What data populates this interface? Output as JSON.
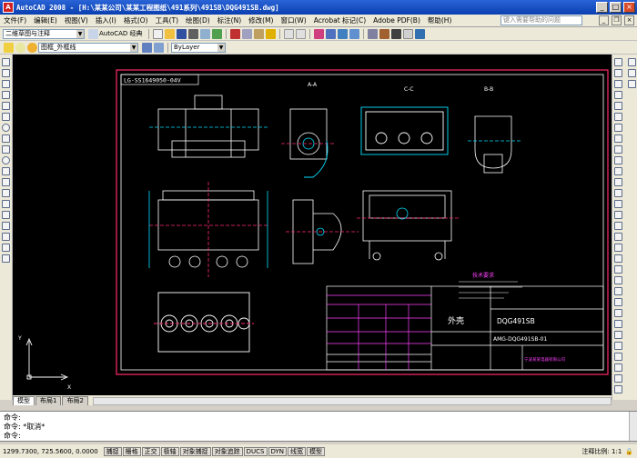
{
  "window": {
    "title": "AutoCAD 2008 - [H:\\某某公司\\某某工程图纸\\491系列\\491SB\\DQG491SB.dwg]"
  },
  "menu": [
    "文件(F)",
    "编辑(E)",
    "视图(V)",
    "插入(I)",
    "格式(O)",
    "工具(T)",
    "绘图(D)",
    "标注(N)",
    "修改(M)",
    "窗口(W)",
    "Acrobat 标记(C)",
    "Adobe PDF(B)",
    "帮助(H)"
  ],
  "help_search": {
    "placeholder": "键入需要帮助的问题"
  },
  "toolbar1": {
    "workspace": "二维草图与注释",
    "workspace_label": "AutoCAD 经典"
  },
  "toolbar2": {
    "layer": "图框_外框线",
    "layer_state": "ByLayer"
  },
  "drawing": {
    "doc_code_box": "LG-SS1649050-04V",
    "views": [
      "A-A",
      "C-C",
      "B-B"
    ],
    "title_block": {
      "part_name": "外壳",
      "drawing_no": "DQG491SB",
      "code": "AMG-DQG491SB-01",
      "company": "宁波某某电器有限公司"
    },
    "notes_title": "技术要求"
  },
  "layout_tabs": [
    "模型",
    "布局1",
    "布局2"
  ],
  "command": {
    "line1": "命令:",
    "line2": "命令: *取消*",
    "prompt": "命令:"
  },
  "status": {
    "coords": "1299.7300, 725.5600, 0.0000",
    "buttons": [
      "捕捉",
      "栅格",
      "正交",
      "极轴",
      "对象捕捉",
      "对象追踪",
      "DUCS",
      "DYN",
      "线宽",
      "模型"
    ],
    "right_label": "注释比例: 1:1"
  },
  "colors": {
    "title_bg": "#0a3fb0",
    "canvas_bg": "#000000",
    "frame": "#ff2a6a",
    "lines": "#ffffff",
    "dims": "#00e0ff",
    "accent": "#ff40ff"
  }
}
